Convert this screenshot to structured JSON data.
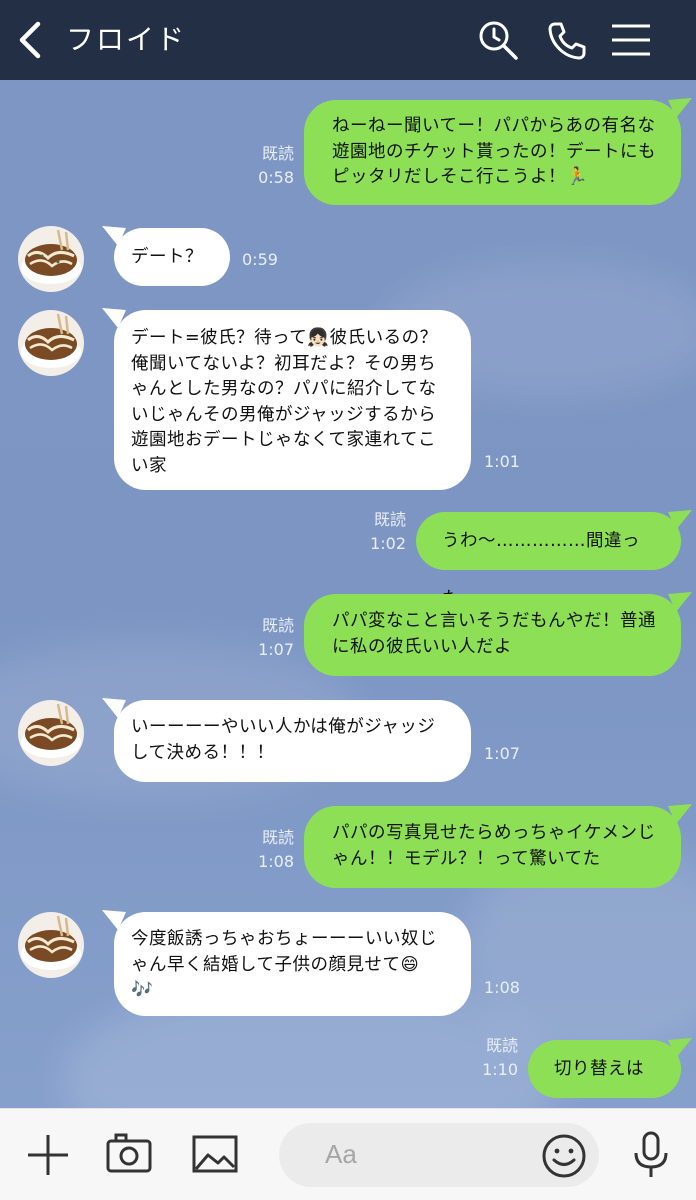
{
  "header": {
    "title": "フロイド"
  },
  "input": {
    "placeholder": "Aa"
  },
  "colors": {
    "header_bg": "#232f45",
    "sent_bubble": "#8de055",
    "received_bubble": "#ffffff",
    "chat_bg": "#7e96c4"
  },
  "messages": [
    {
      "direction": "sent",
      "text": "ねーねー聞いてー！パパからあの有名な\n遊園地のチケット貰ったの！デートにも\nピッタリだしそこ行こうよ！🏃",
      "read": "既読",
      "time": "0:58"
    },
    {
      "direction": "received",
      "text": "デート？",
      "time": "0:59"
    },
    {
      "direction": "received",
      "text": "デート=彼氏？待って👧🏻彼氏いるの？\n俺聞いてないよ？初耳だよ？その男ち\nゃんとした男なの？パパに紹介してな\nいじゃんその男俺がジャッジするから\n遊園地おデートじゃなくて家連れてこ\nい家",
      "time": "1:01"
    },
    {
      "direction": "sent",
      "text": "うわ〜……………間違った",
      "read": "既読",
      "time": "1:02"
    },
    {
      "direction": "sent",
      "text": "パパ変なこと言いそうだもんやだ！普通\nに私の彼氏いい人だよ",
      "read": "既読",
      "time": "1:07"
    },
    {
      "direction": "received",
      "text": "いーーーーやいい人かは俺がジャッジ\nして決める！！！",
      "time": "1:07"
    },
    {
      "direction": "sent",
      "text": "パパの写真見せたらめっちゃイケメンじ\nゃん！！モデル？！って驚いてた",
      "read": "既読",
      "time": "1:08"
    },
    {
      "direction": "received",
      "text": "今度飯誘っちゃおちょーーーいい奴じ\nゃん早く結婚して子供の顔見せて😄\n🎶",
      "time": "1:08"
    },
    {
      "direction": "sent",
      "text": "切り替えはや",
      "read": "既読",
      "time": "1:10"
    }
  ]
}
